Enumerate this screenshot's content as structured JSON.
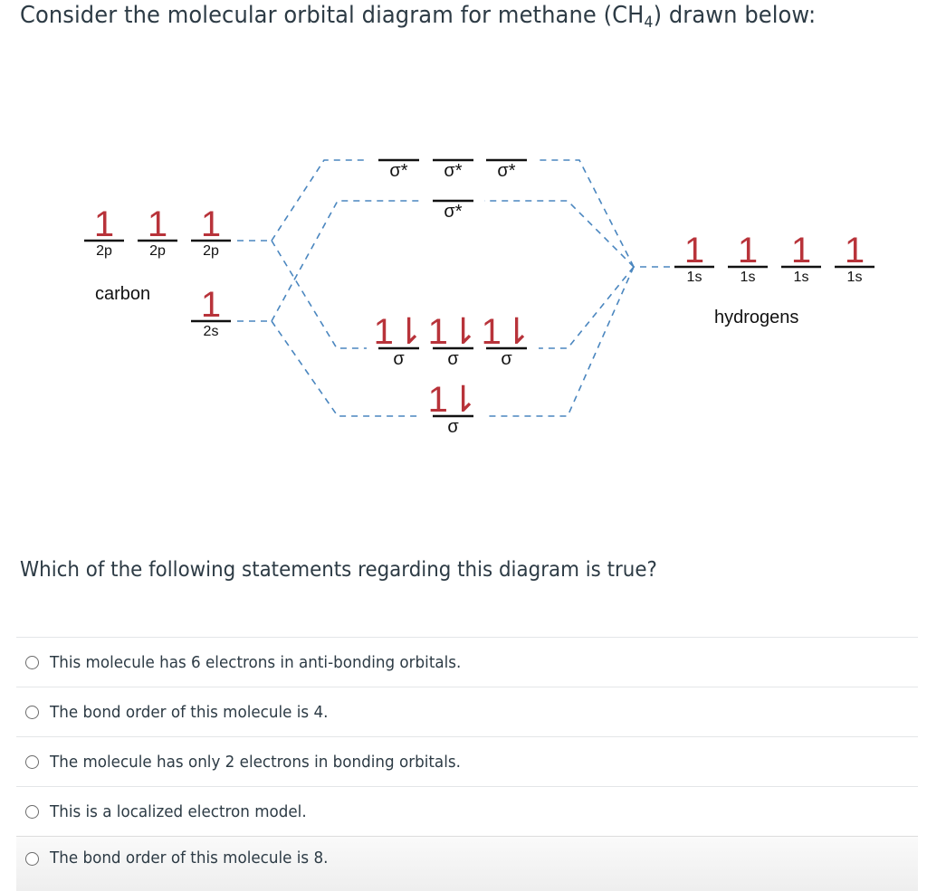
{
  "question": {
    "title_before_sub": "Consider the molecular orbital diagram for  methane (CH",
    "title_sub": "4",
    "title_after_sub": ") drawn below:",
    "prompt": "Which of the following statements regarding this diagram is true?"
  },
  "diagram": {
    "carbon": {
      "group_label": "carbon",
      "orbitals": [
        {
          "label": "2p",
          "electrons": "1"
        },
        {
          "label": "2p",
          "electrons": "1"
        },
        {
          "label": "2p",
          "electrons": "1"
        },
        {
          "label": "2s",
          "electrons": "1"
        }
      ]
    },
    "hydrogens": {
      "group_label": "hydrogens",
      "orbitals": [
        {
          "label": "1s",
          "electrons": "1"
        },
        {
          "label": "1s",
          "electrons": "1"
        },
        {
          "label": "1s",
          "electrons": "1"
        },
        {
          "label": "1s",
          "electrons": "1"
        }
      ]
    },
    "molecular_orbitals": {
      "antibonding": [
        {
          "label": "σ*",
          "electrons": ""
        },
        {
          "label": "σ*",
          "electrons": ""
        },
        {
          "label": "σ*",
          "electrons": ""
        },
        {
          "label": "σ*",
          "electrons": ""
        }
      ],
      "bonding": [
        {
          "label": "σ",
          "electrons": "1⇂"
        },
        {
          "label": "σ",
          "electrons": "1⇂"
        },
        {
          "label": "σ",
          "electrons": "1⇂"
        },
        {
          "label": "σ",
          "electrons": "1⇂"
        }
      ]
    },
    "colors": {
      "electron": "#b8333a",
      "connector": "#4a86bf",
      "level": "#111111"
    }
  },
  "answers": [
    {
      "text": "This molecule has 6 electrons in anti-bonding orbitals.",
      "selected": false
    },
    {
      "text": "The bond order of this molecule is 4.",
      "selected": false
    },
    {
      "text": "The molecule has only 2 electrons in bonding orbitals.",
      "selected": false
    },
    {
      "text": "This is a localized electron model.",
      "selected": false
    },
    {
      "text": "The bond order of this molecule is 8.",
      "selected": false
    }
  ]
}
